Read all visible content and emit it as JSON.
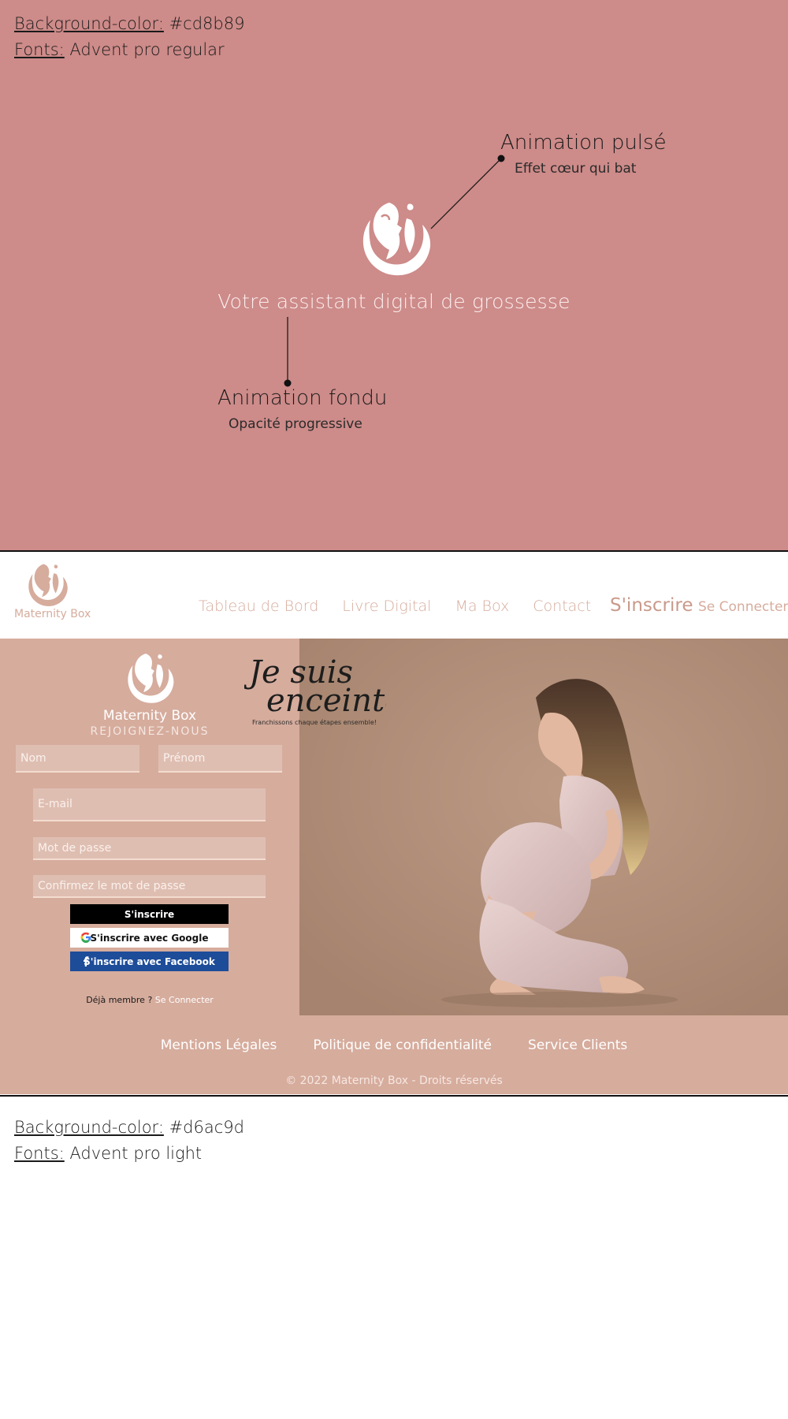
{
  "splash": {
    "bg_label": "Background-color:",
    "bg_value": " #cd8b89",
    "font_label": "Fonts:",
    "font_value": " Advent pro regular",
    "tagline": "Votre assistant digital de grossesse",
    "pulse_title": "Animation pulsé",
    "pulse_sub": "Effet cœur qui bat",
    "fade_title": "Animation fondu",
    "fade_sub": "Opacité progressive"
  },
  "header": {
    "brand": "Maternity Box",
    "nav": [
      "Tableau de Bord",
      "Livre Digital",
      "Ma Box",
      "Contact"
    ],
    "signup": "S'inscrire",
    "login": "Se Connecter"
  },
  "form": {
    "brand": "Maternity Box",
    "join": "REJOIGNEZ-NOUS",
    "nom_placeholder": "Nom",
    "prenom_placeholder": "Prénom",
    "email_placeholder": "E-mail",
    "password_placeholder": "Mot de passe",
    "confirm_placeholder": "Confirmez le mot de passe",
    "signup_button": "S'inscrire",
    "google_button": "S'inscrire avec Google",
    "facebook_button": "S'inscrire avec Facebook",
    "member_text": "Déjà membre ? ",
    "member_link": "Se Connecter"
  },
  "hero": {
    "script_line1": "Je suis",
    "script_line2": "enceinte!",
    "script_sub": "Franchissons chaque étapes ensemble!"
  },
  "footer": {
    "links": [
      "Mentions Légales",
      "Politique de confidentialité",
      "Service Clients"
    ],
    "copyright": "© 2022 Maternity Box - Droits réservés"
  },
  "page_spec": {
    "bg_label": "Background-color:",
    "bg_value": " #d6ac9d",
    "font_label": "Fonts:",
    "font_value": " Advent pro light"
  },
  "colors": {
    "splash_bg": "#cd8b89",
    "page_accent": "#d6ac9d",
    "facebook_blue": "#1d4c99"
  },
  "icons": [
    "maternity-logo-icon",
    "google-icon",
    "facebook-icon"
  ]
}
